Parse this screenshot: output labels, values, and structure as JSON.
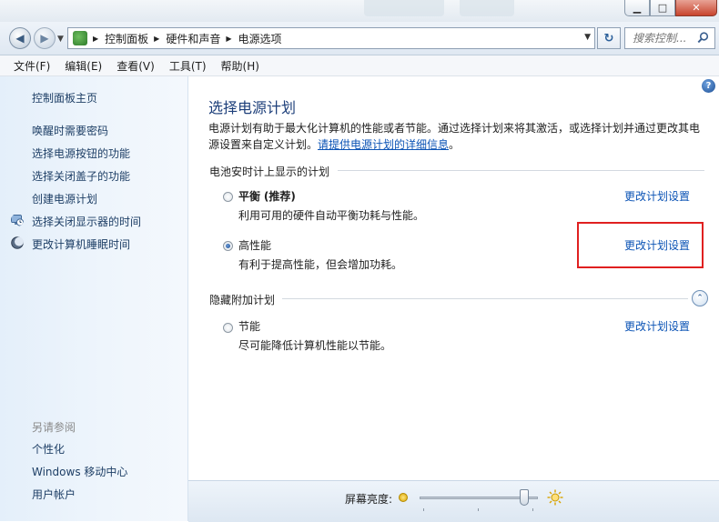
{
  "window": {
    "minimize_symbol": "▁",
    "maximize_symbol": "□",
    "close_symbol": "✕"
  },
  "address_bar": {
    "breadcrumbs": [
      "控制面板",
      "硬件和声音",
      "电源选项"
    ],
    "refresh_icon": "refresh-icon",
    "search_placeholder": "搜索控制..."
  },
  "menu": [
    "文件(F)",
    "编辑(E)",
    "查看(V)",
    "工具(T)",
    "帮助(H)"
  ],
  "sidebar": {
    "home": "控制面板主页",
    "links": [
      {
        "label": "唤醒时需要密码",
        "icon": ""
      },
      {
        "label": "选择电源按钮的功能",
        "icon": ""
      },
      {
        "label": "选择关闭盖子的功能",
        "icon": ""
      },
      {
        "label": "创建电源计划",
        "icon": ""
      },
      {
        "label": "选择关闭显示器的时间",
        "icon": "monitor-clock-icon"
      },
      {
        "label": "更改计算机睡眠时间",
        "icon": "moon-icon"
      }
    ],
    "see_also_title": "另请参阅",
    "see_also": [
      "个性化",
      "Windows 移动中心",
      "用户帐户"
    ]
  },
  "main": {
    "help_symbol": "?",
    "title": "选择电源计划",
    "description": "电源计划有助于最大化计算机的性能或者节能。通过选择计划来将其激活，或选择计划并通过更改其电源设置来自定义计划。",
    "description_link": "请提供电源计划的详细信息",
    "description_end": "。",
    "battery_group_title": "电池安时计上显示的计划",
    "plans": [
      {
        "name": "平衡",
        "suffix": "(推荐)",
        "description": "利用可用的硬件自动平衡功耗与性能。",
        "link": "更改计划设置",
        "selected": false
      },
      {
        "name": "高性能",
        "suffix": "",
        "description": "有利于提高性能，但会增加功耗。",
        "link": "更改计划设置",
        "selected": true
      }
    ],
    "hidden_group_title": "隐藏附加计划",
    "collapse_symbol": "⌃",
    "hidden_plans": [
      {
        "name": "节能",
        "description": "尽可能降低计算机性能以节能。",
        "link": "更改计划设置",
        "selected": false
      }
    ]
  },
  "bottom_bar": {
    "brightness_label": "屏幕亮度:",
    "brightness_level": 0.92
  },
  "colors": {
    "link": "#0b53b5",
    "title": "#1d3f7a",
    "highlight_box": "#e02020"
  }
}
